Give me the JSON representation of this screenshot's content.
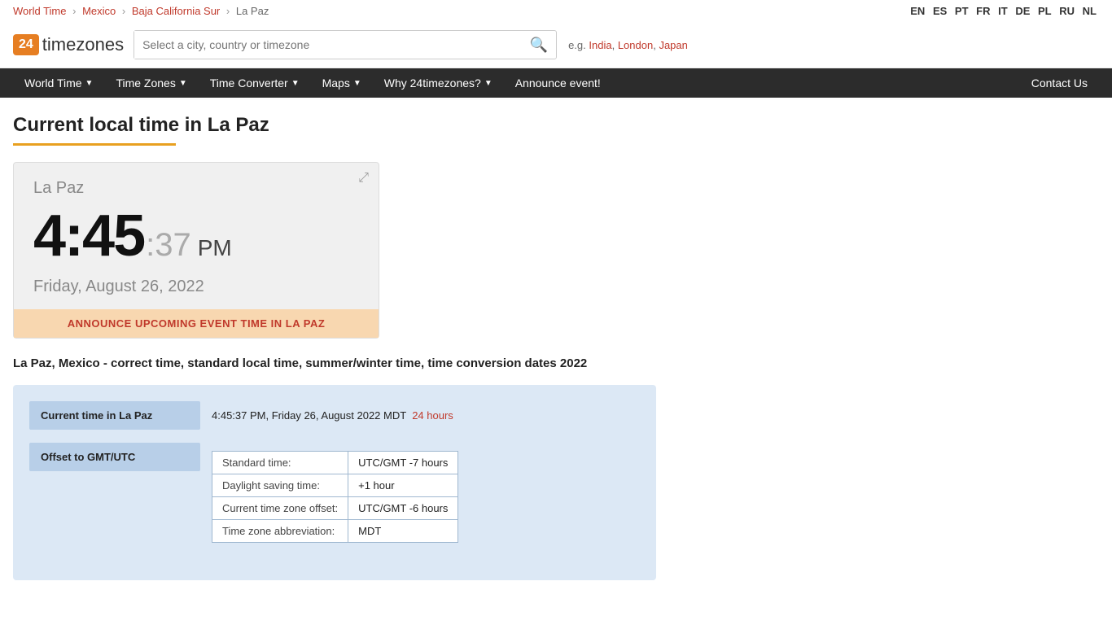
{
  "languages": [
    "EN",
    "ES",
    "PT",
    "FR",
    "IT",
    "DE",
    "PL",
    "RU",
    "NL"
  ],
  "active_lang": "EN",
  "breadcrumb": {
    "items": [
      {
        "label": "World Time",
        "href": "#"
      },
      {
        "label": "Mexico",
        "href": "#"
      },
      {
        "label": "Baja California Sur",
        "href": "#"
      },
      {
        "label": "La Paz",
        "href": null
      }
    ]
  },
  "logo": {
    "badge": "24",
    "text": "timezones"
  },
  "search": {
    "placeholder": "Select a city, country or timezone"
  },
  "search_examples": {
    "prefix": "e.g.",
    "items": [
      "India",
      "London",
      "Japan"
    ]
  },
  "nav": {
    "items": [
      {
        "label": "World Time",
        "has_arrow": true
      },
      {
        "label": "Time Zones",
        "has_arrow": true
      },
      {
        "label": "Time Converter",
        "has_arrow": true
      },
      {
        "label": "Maps",
        "has_arrow": true
      },
      {
        "label": "Why 24timezones?",
        "has_arrow": true
      },
      {
        "label": "Announce event!",
        "has_arrow": false
      }
    ],
    "contact": "Contact Us"
  },
  "page": {
    "title": "Current local time in La Paz",
    "city": "La Paz",
    "time_main": "4:45",
    "time_seconds": ":37",
    "time_ampm": "PM",
    "date": "Friday, August 26, 2022",
    "announce_btn": "ANNOUNCE UPCOMING EVENT TIME IN LA PAZ",
    "description": "La Paz, Mexico - correct time, standard local time, summer/winter time, time conversion dates 2022"
  },
  "info": {
    "current_time_label": "Current time in La Paz",
    "current_time_value": "4:45:37 PM, Friday 26, August 2022 MDT",
    "current_time_link": "24 hours",
    "offset_label": "Offset to GMT/UTC",
    "gmt_rows": [
      {
        "label": "Standard time:",
        "value": "UTC/GMT -7 hours"
      },
      {
        "label": "Daylight saving time:",
        "value": "+1 hour"
      },
      {
        "label": "Current time zone offset:",
        "value": "UTC/GMT -6 hours"
      },
      {
        "label": "Time zone abbreviation:",
        "value": "MDT"
      }
    ]
  }
}
